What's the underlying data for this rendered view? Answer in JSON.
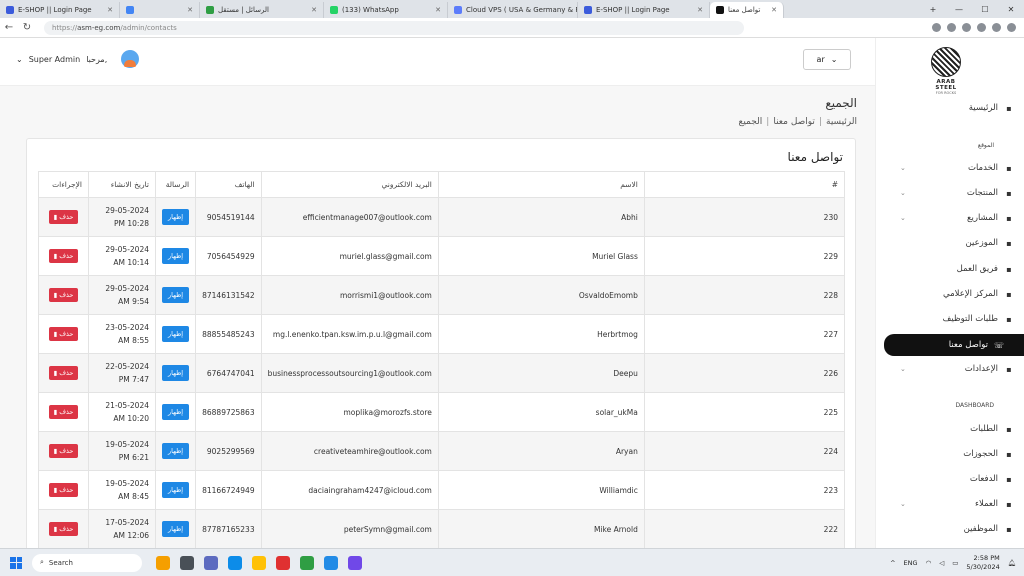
{
  "browser": {
    "tabs": [
      {
        "title": "E-SHOP || Login Page",
        "color": "#3b5bdb",
        "active": false
      },
      {
        "title": "",
        "color": "#4285f4",
        "active": false
      },
      {
        "title": "الرسائل | مستقل",
        "color": "#2f9e44",
        "active": false
      },
      {
        "title": "(133) WhatsApp",
        "color": "#25d366",
        "active": false
      },
      {
        "title": "Cloud VPS ( USA & Germany & F",
        "color": "#5c7cfa",
        "active": false
      },
      {
        "title": "E-SHOP || Login Page",
        "color": "#3b5bdb",
        "active": false
      },
      {
        "title": "تواصل معنا",
        "color": "#111111",
        "active": true
      }
    ],
    "url_prefix": "https://",
    "url_host": "asm-eg.com",
    "url_path": "/admin/contacts"
  },
  "header": {
    "user_name": "Super Admin",
    "greeting": "مرحبا,",
    "language": "ar"
  },
  "page": {
    "title": "الجميع",
    "breadcrumb": [
      "الرئيسية",
      "تواصل معنا",
      "الجميع"
    ]
  },
  "card": {
    "title": "تواصل معنا",
    "columns": {
      "id": "#",
      "name": "الاسم",
      "email": "البريد الالكتروني",
      "phone": "الهاتف",
      "message": "الرسالة",
      "created": "تاريخ الانشاء",
      "actions": "الإجراءات"
    },
    "show_label": "إظهار",
    "delete_label": "حذف",
    "rows": [
      {
        "id": "230",
        "name": "Abhi",
        "email": "efficientmanage007@outlook.com",
        "phone": "9054519144",
        "date": "29-05-2024",
        "time": "PM 10:28"
      },
      {
        "id": "229",
        "name": "Muriel Glass",
        "email": "muriel.glass@gmail.com",
        "phone": "7056454929",
        "date": "29-05-2024",
        "time": "AM 10:14"
      },
      {
        "id": "228",
        "name": "OsvaldoEmomb",
        "email": "morrismi1@outlook.com",
        "phone": "87146131542",
        "date": "29-05-2024",
        "time": "AM 9:54"
      },
      {
        "id": "227",
        "name": "Herbrtmog",
        "email": "mg.l.enenko.tpan.ksw.im.p.u.l@gmail.com",
        "phone": "88855485243",
        "date": "23-05-2024",
        "time": "AM 8:55"
      },
      {
        "id": "226",
        "name": "Deepu",
        "email": "businessprocessoutsourcing1@outlook.com",
        "phone": "6764747041",
        "date": "22-05-2024",
        "time": "PM 7:47"
      },
      {
        "id": "225",
        "name": "solar_ukMa",
        "email": "moplika@morozfs.store",
        "phone": "86889725863",
        "date": "21-05-2024",
        "time": "AM 10:20"
      },
      {
        "id": "224",
        "name": "Aryan",
        "email": "creativeteamhire@outlook.com",
        "phone": "9025299569",
        "date": "19-05-2024",
        "time": "PM 6:21"
      },
      {
        "id": "223",
        "name": "Williamdic",
        "email": "daciaingraham4247@icloud.com",
        "phone": "81166724949",
        "date": "19-05-2024",
        "time": "AM 8:45"
      },
      {
        "id": "222",
        "name": "Mike Arnold",
        "email": "peterSymn@gmail.com",
        "phone": "87787165233",
        "date": "17-05-2024",
        "time": "AM 12:06"
      }
    ]
  },
  "sidebar": {
    "logo_text": "ARAB STEEL",
    "logo_sub": "FOR ROCKS",
    "home": "الرئيسية",
    "section_site": "الموقع",
    "items": [
      "الخدمات",
      "المنتجات",
      "المشاريع",
      "الموزعين",
      "فريق العمل",
      "المركز الإعلامي",
      "طلبات التوظيف",
      "تواصل معنا",
      "الإعدادات"
    ],
    "section_dashboard": "DASHBOARD",
    "dash_items": [
      "الطلبات",
      "الحجوزات",
      "الدفعات",
      "العملاء",
      "الموظفين"
    ]
  },
  "taskbar": {
    "search": "Search",
    "lang": "ENG",
    "time": "2:58 PM",
    "date": "5/30/2024"
  }
}
